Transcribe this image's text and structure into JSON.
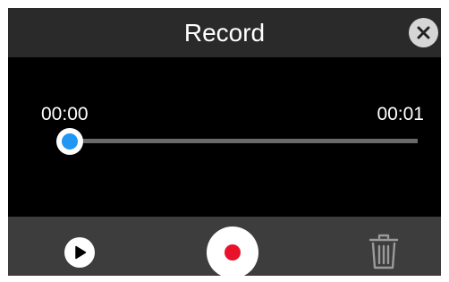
{
  "dialog": {
    "title": "Record",
    "close_icon": "close-icon"
  },
  "player": {
    "current_time": "00:00",
    "total_time": "00:01",
    "progress": 0
  },
  "controls": {
    "play_icon": "play-icon",
    "record_icon": "record-icon",
    "delete_icon": "trash-icon"
  },
  "colors": {
    "background": "#000000",
    "titlebar": "#2a2a2a",
    "controls_bar": "#3d3d3d",
    "slider_track": "#6a6a6a",
    "slider_accent": "#2196f3",
    "record_red": "#e8132b",
    "close_button": "#d6d6d6"
  }
}
